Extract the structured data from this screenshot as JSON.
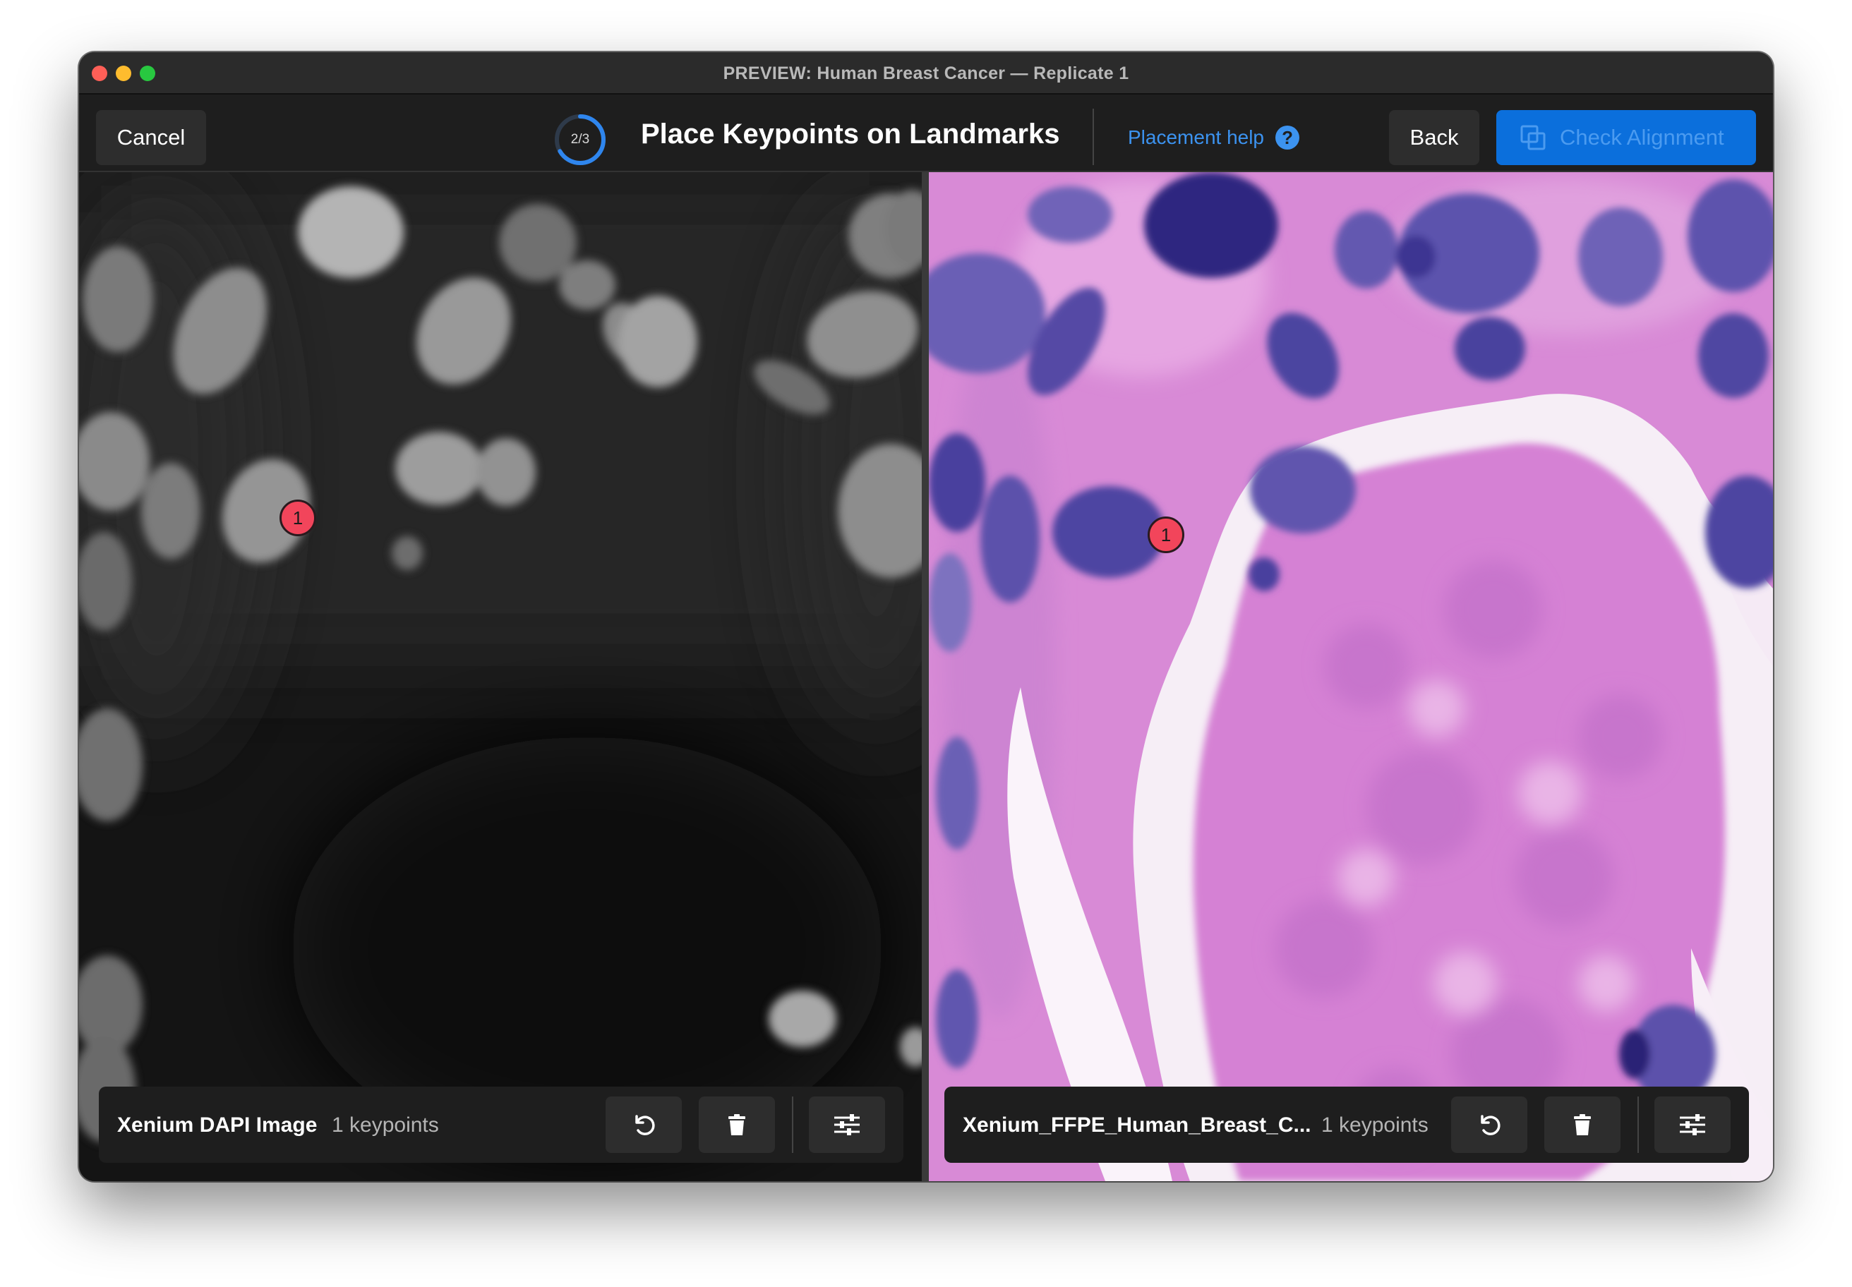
{
  "window": {
    "title": "PREVIEW: Human Breast Cancer — Replicate 1"
  },
  "toolbar": {
    "cancel_label": "Cancel",
    "step": {
      "label": "2/3",
      "current": 2,
      "total": 3
    },
    "heading": "Place Keypoints on Landmarks",
    "help_label": "Placement help",
    "help_icon": "question-circle-icon",
    "back_label": "Back",
    "check_label": "Check Alignment",
    "check_icon": "overlap-squares-icon"
  },
  "left_pane": {
    "image_name": "Xenium DAPI Image",
    "keypoint_count": "1 keypoints",
    "keypoints": [
      {
        "label": "1"
      }
    ],
    "tools": [
      "undo-icon",
      "trash-icon",
      "sliders-icon"
    ]
  },
  "right_pane": {
    "image_name": "Xenium_FFPE_Human_Breast_C...",
    "keypoint_count": "1 keypoints",
    "keypoints": [
      {
        "label": "1"
      }
    ],
    "tools": [
      "undo-icon",
      "trash-icon",
      "sliders-icon"
    ]
  },
  "colors": {
    "accent": "#0b6fdc",
    "keypoint": "#f2455b",
    "help": "#3c93f0",
    "he_background": "#d88ad6",
    "he_nucleus": "#4a3fa0"
  }
}
